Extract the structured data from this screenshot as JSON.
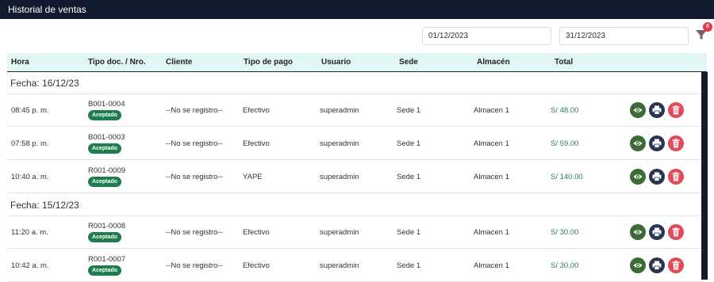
{
  "header": {
    "title": "Historial de ventas"
  },
  "filters": {
    "date_from": "01/12/2023",
    "date_to": "31/12/2023",
    "filter_count": "0"
  },
  "columns": [
    "Hora",
    "Tipo doc. / Nro.",
    "Cliente",
    "Tipo de pago",
    "Usuario",
    "Sede",
    "Almacén",
    "Total"
  ],
  "groups": [
    {
      "label": "Fecha: 16/12/23",
      "rows": [
        {
          "hora": "08:45 p. m.",
          "doc": "B001-0004",
          "estado": "Aceptado",
          "cliente": "--No se registro--",
          "pago": "Efectivo",
          "usuario": "superadmin",
          "sede": "Sede 1",
          "almacen": "Almacen 1",
          "total": "S/  48.00"
        },
        {
          "hora": "07:58 p. m.",
          "doc": "B001-0003",
          "estado": "Aceptado",
          "cliente": "--No se registro--",
          "pago": "Efectivo",
          "usuario": "superadmin",
          "sede": "Sede 1",
          "almacen": "Almacen 1",
          "total": "S/  59.00"
        },
        {
          "hora": "10:40 a. m.",
          "doc": "R001-0009",
          "estado": "Aceptado",
          "cliente": "--No se registro--",
          "pago": "YAPE",
          "usuario": "superadmin",
          "sede": "Sede 1",
          "almacen": "Almacen 1",
          "total": "S/  140.00"
        }
      ]
    },
    {
      "label": "Fecha: 15/12/23",
      "rows": [
        {
          "hora": "11:20 a. m.",
          "doc": "R001-0008",
          "estado": "Aceptado",
          "cliente": "--No se registro--",
          "pago": "Efectivo",
          "usuario": "superadmin",
          "sede": "Sede 1",
          "almacen": "Almacen 1",
          "total": "S/  30.00"
        },
        {
          "hora": "10:42 a. m.",
          "doc": "R001-0007",
          "estado": "Aceptado",
          "cliente": "--No se registro--",
          "pago": "Efectivo",
          "usuario": "superadmin",
          "sede": "Sede 1",
          "almacen": "Almacen 1",
          "total": "S/  30.00"
        }
      ]
    }
  ],
  "icons": {
    "view": "eye-icon",
    "print": "printer-icon",
    "delete": "trash-icon",
    "filter": "filter-icon"
  },
  "colors": {
    "topbar": "#121a2f",
    "header_bg": "#e2f6f5",
    "accepted": "#1e7d4f",
    "view": "#3c6b36",
    "print": "#2a3453",
    "delete": "#e04a59",
    "total": "#2c7b56"
  }
}
